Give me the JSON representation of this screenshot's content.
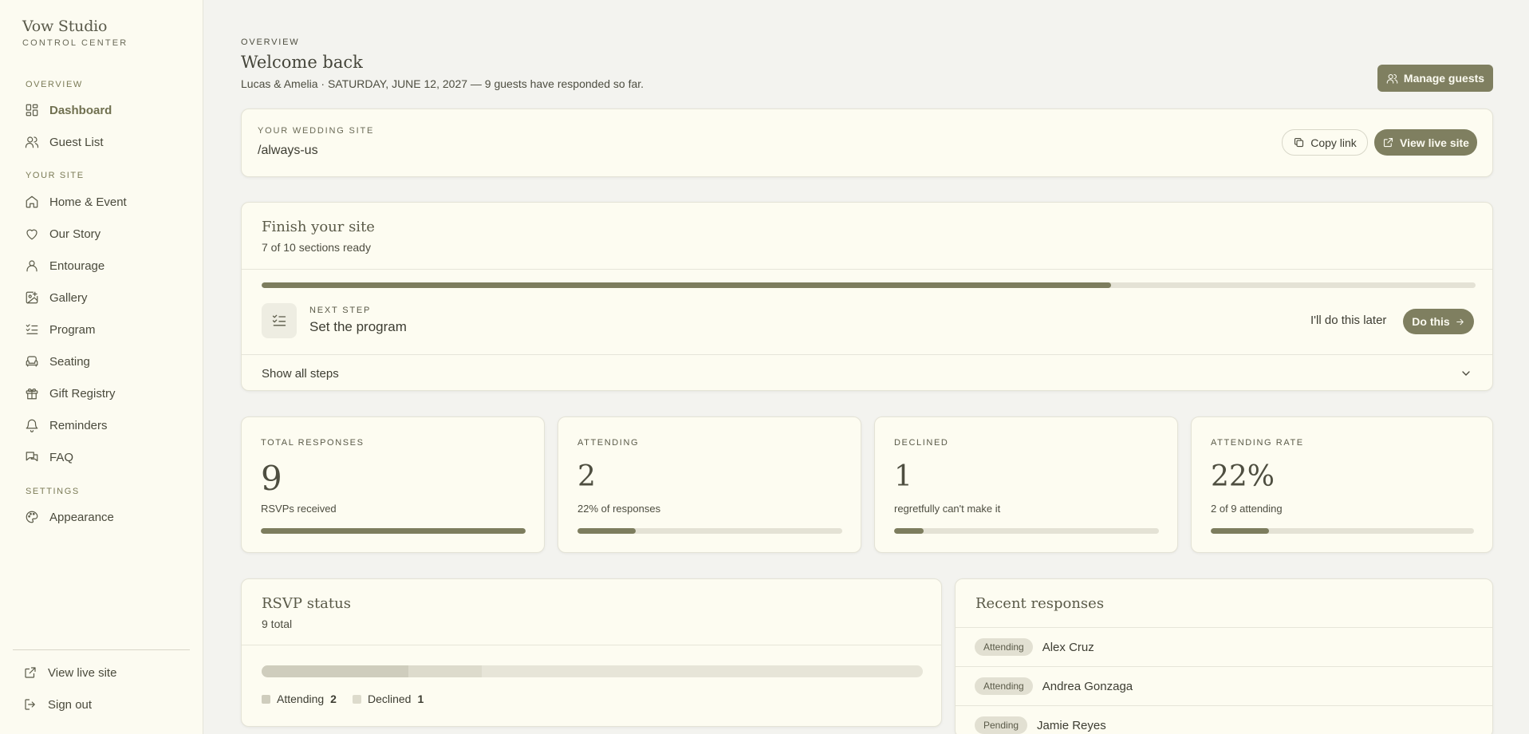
{
  "brand": {
    "name": "Vow Studio",
    "subtitle": "CONTROL CENTER"
  },
  "sidebar": {
    "sections": {
      "overview": "OVERVIEW",
      "your_site": "YOUR SITE",
      "settings": "SETTINGS"
    },
    "items": [
      {
        "label": "Dashboard",
        "icon": "dashboard-icon",
        "active": true
      },
      {
        "label": "Guest List",
        "icon": "users-icon"
      },
      {
        "label": "Home & Event",
        "icon": "home-icon"
      },
      {
        "label": "Our Story",
        "icon": "heart-icon"
      },
      {
        "label": "Entourage",
        "icon": "user-icon"
      },
      {
        "label": "Gallery",
        "icon": "image-plus-icon"
      },
      {
        "label": "Program",
        "icon": "list-check-icon"
      },
      {
        "label": "Seating",
        "icon": "sofa-icon"
      },
      {
        "label": "Gift Registry",
        "icon": "gift-icon"
      },
      {
        "label": "Reminders",
        "icon": "bell-icon"
      },
      {
        "label": "FAQ",
        "icon": "chat-icon"
      },
      {
        "label": "Appearance",
        "icon": "palette-icon"
      }
    ],
    "footer": {
      "view_live": "View live site",
      "sign_out": "Sign out"
    }
  },
  "header": {
    "eyebrow": "OVERVIEW",
    "title": "Welcome back",
    "subtitle": "Lucas & Amelia · SATURDAY, JUNE 12, 2027 — 9 guests have responded so far.",
    "manage_button": "Manage guests"
  },
  "site_card": {
    "label": "YOUR WEDDING SITE",
    "slug": "/always-us",
    "copy_button": "Copy link",
    "view_button": "View live site"
  },
  "finish_card": {
    "title": "Finish your site",
    "progress_text": "7 of 10 sections ready",
    "progress": 0.7,
    "next_label": "NEXT STEP",
    "next_title": "Set the program",
    "later_button": "I'll do this later",
    "do_button": "Do this",
    "show_steps": "Show all steps"
  },
  "stats": [
    {
      "label": "TOTAL RESPONSES",
      "value": "9",
      "note": "RSVPs received",
      "fill": 1.0
    },
    {
      "label": "ATTENDING",
      "value": "2",
      "note": "22% of responses",
      "fill": 0.22
    },
    {
      "label": "DECLINED",
      "value": "1",
      "note": "regretfully can't make it",
      "fill": 0.11
    },
    {
      "label": "ATTENDING RATE",
      "value": "22%",
      "note": "2 of 9 attending",
      "fill": 0.22
    }
  ],
  "rsvp": {
    "title": "RSVP status",
    "total": "9 total",
    "attending_fraction": 0.222,
    "declined_fraction": 0.111,
    "legend": [
      {
        "label": "Attending",
        "count": "2"
      },
      {
        "label": "Declined",
        "count": "1"
      }
    ]
  },
  "recent": {
    "title": "Recent responses",
    "rows": [
      {
        "status": "Attending",
        "name": "Alex Cruz"
      },
      {
        "status": "Attending",
        "name": "Andrea Gonzaga"
      },
      {
        "status": "Pending",
        "name": "Jamie Reyes"
      }
    ]
  },
  "colors": {
    "accent": "#7f7f60",
    "background": "#f3f3ef",
    "card": "#fdfcf1"
  }
}
